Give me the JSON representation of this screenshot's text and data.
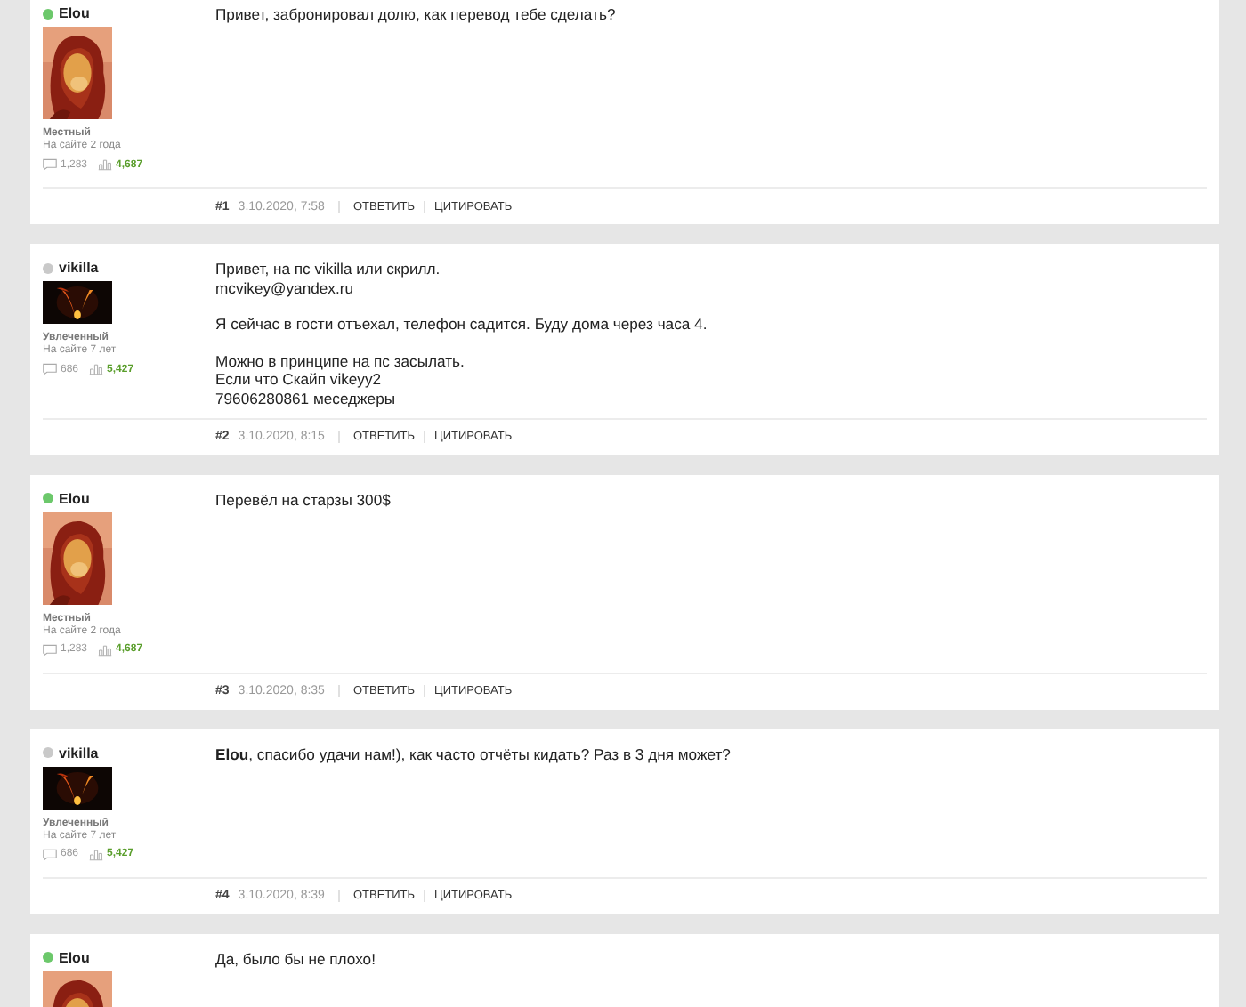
{
  "posts": [
    {
      "author": "Elou",
      "online": true,
      "avatar": {
        "kind": "portrait"
      },
      "rank": "Местный",
      "since": "На сайте 2 года",
      "messages": "1,283",
      "likes": "4,687",
      "paragraphs": [
        "Привет, забронировал долю, как перевод тебе сделать?"
      ],
      "number": "#1",
      "date": "3.10.2020, 7:58",
      "actions": [
        "ОТВЕТИТЬ",
        "ЦИТИРОВАТЬ"
      ]
    },
    {
      "author": "vikilla",
      "online": false,
      "avatar": {
        "kind": "banner"
      },
      "rank": "Увлеченный",
      "since": "На сайте 7 лет",
      "messages": "686",
      "likes": "5,427",
      "paragraphs": [
        "Привет, на пс vikilla или скрилл.\nmcvikey@yandex.ru",
        "Я сейчас в гости отъехал, телефон садится. Буду дома через часа 4.",
        "Можно в принципе на пс засылать.\nЕсли что Скайп vikeyy2\n79606280861 меседжеры"
      ],
      "number": "#2",
      "date": "3.10.2020, 8:15",
      "actions": [
        "ОТВЕТИТЬ",
        "ЦИТИРОВАТЬ"
      ]
    },
    {
      "author": "Elou",
      "online": true,
      "avatar": {
        "kind": "portrait"
      },
      "rank": "Местный",
      "since": "На сайте 2 года",
      "messages": "1,283",
      "likes": "4,687",
      "paragraphs": [
        "Перевёл на старзы 300$"
      ],
      "number": "#3",
      "date": "3.10.2020, 8:35",
      "actions": [
        "ОТВЕТИТЬ",
        "ЦИТИРОВАТЬ"
      ]
    },
    {
      "author": "vikilla",
      "online": false,
      "avatar": {
        "kind": "banner"
      },
      "rank": "Увлеченный",
      "since": "На сайте 7 лет",
      "messages": "686",
      "likes": "5,427",
      "paragraphs": [
        "**Elou**, спасибо удачи нам!), как часто отчёты кидать? Раз в 3 дня может?"
      ],
      "number": "#4",
      "date": "3.10.2020, 8:39",
      "actions": [
        "ОТВЕТИТЬ",
        "ЦИТИРОВАТЬ"
      ]
    },
    {
      "author": "Elou",
      "online": true,
      "avatar": {
        "kind": "portrait"
      },
      "paragraphs": [
        "Да, было бы не плохо!"
      ]
    }
  ]
}
